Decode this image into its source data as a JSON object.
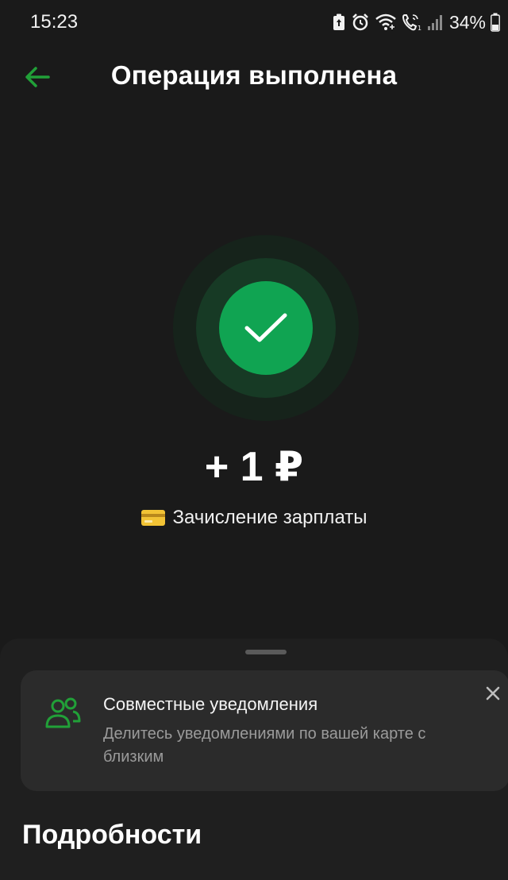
{
  "status_bar": {
    "time": "15:23",
    "battery_percent": "34%",
    "icons": [
      "battery-saver-icon",
      "alarm-icon",
      "wifi-icon",
      "volte-call-icon",
      "signal-icon",
      "battery-icon"
    ]
  },
  "header": {
    "title": "Операция выполнена",
    "back_icon": "arrow-left-icon"
  },
  "result": {
    "status_icon": "checkmark-icon",
    "amount": "+ 1 ₽",
    "description": "Зачисление зарплаты",
    "description_icon": "credit-card-icon"
  },
  "sheet": {
    "promo": {
      "icon": "people-icon",
      "title": "Совместные уведомления",
      "text": "Делитесь уведомлениями по вашей карте с близким",
      "close_icon": "close-icon"
    },
    "details_title": "Подробности"
  },
  "colors": {
    "background": "#1a1a1a",
    "accent_green": "#10a452",
    "back_arrow": "#21a038",
    "card_bg": "#2b2b2b"
  }
}
